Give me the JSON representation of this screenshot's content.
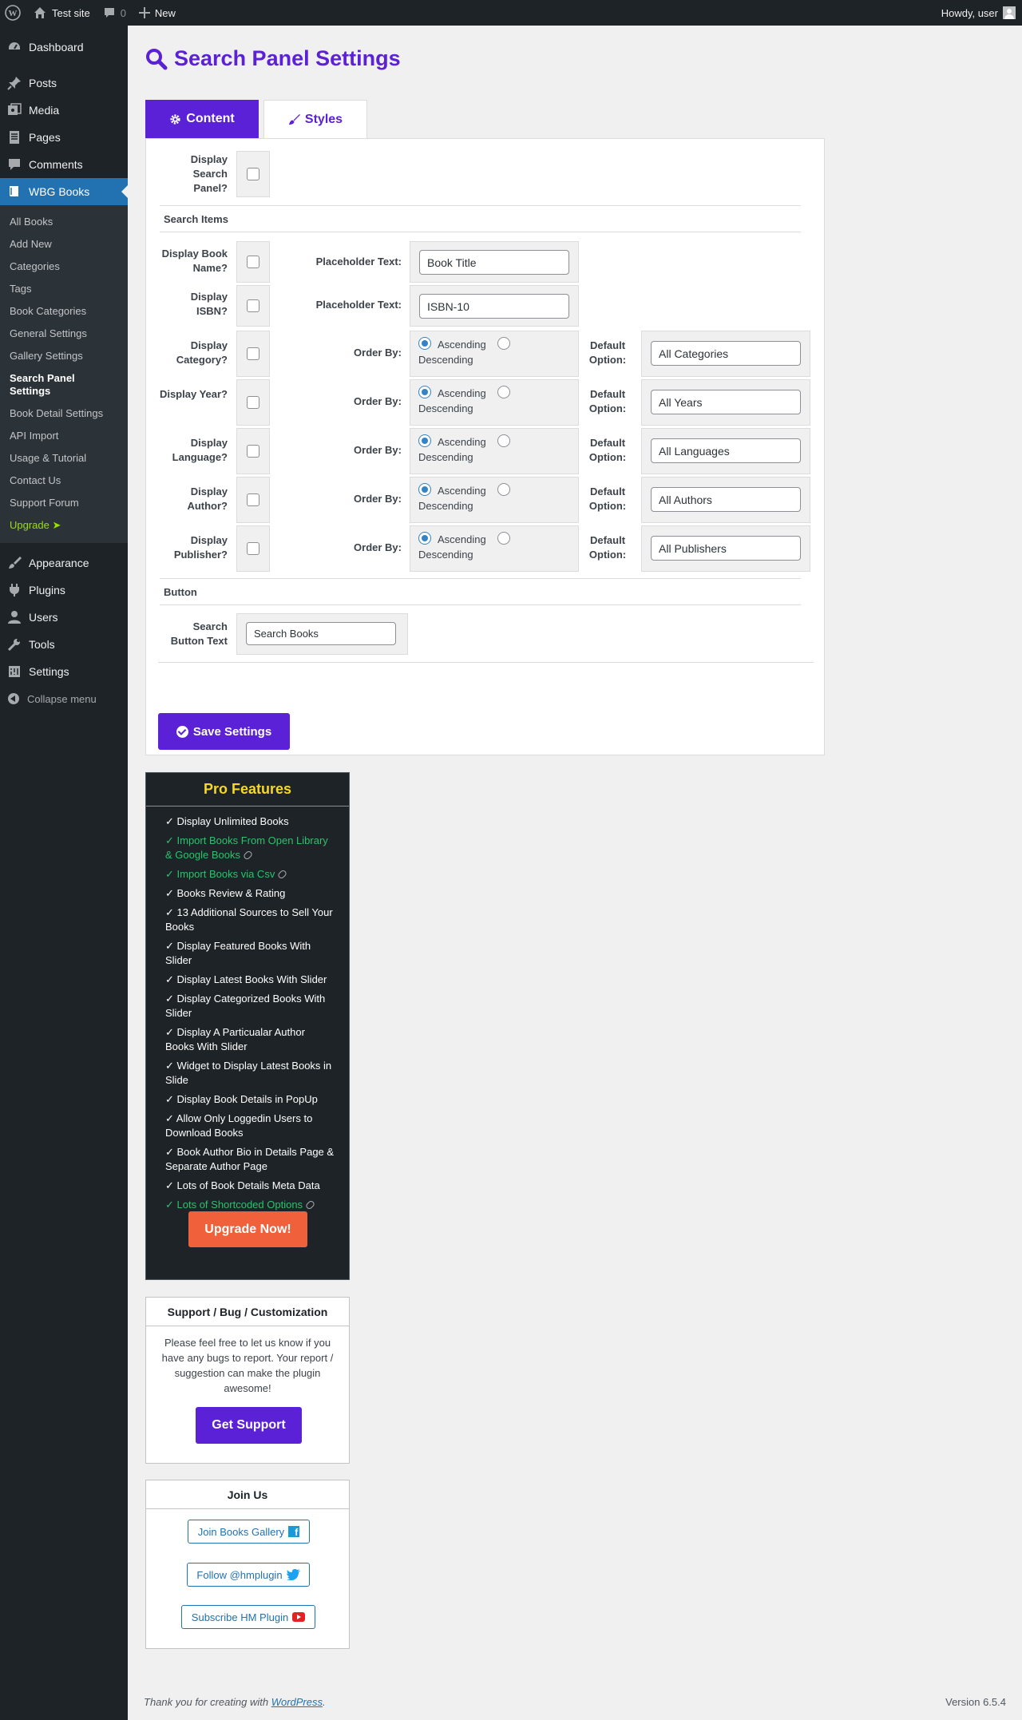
{
  "adminbar": {
    "site_name": "Test site",
    "comments_count": "0",
    "new_label": "New",
    "howdy": "Howdy, user"
  },
  "sidebar": {
    "top_items": [
      {
        "label": "Dashboard",
        "icon": "dashboard-icon"
      },
      {
        "label": "Posts",
        "icon": "pin-icon"
      },
      {
        "label": "Media",
        "icon": "media-icon"
      },
      {
        "label": "Pages",
        "icon": "pages-icon"
      },
      {
        "label": "Comments",
        "icon": "comment-icon"
      },
      {
        "label": "WBG Books",
        "icon": "book-icon"
      }
    ],
    "submenu": [
      "All Books",
      "Add New",
      "Categories",
      "Tags",
      "Book Categories",
      "General Settings",
      "Gallery Settings",
      "Search Panel Settings",
      "Book Detail Settings",
      "API Import",
      "Usage & Tutorial",
      "Contact Us",
      "Support Forum",
      "Upgrade ➤"
    ],
    "bottom_items": [
      {
        "label": "Appearance",
        "icon": "brush-icon"
      },
      {
        "label": "Plugins",
        "icon": "plugin-icon"
      },
      {
        "label": "Users",
        "icon": "user-icon"
      },
      {
        "label": "Tools",
        "icon": "wrench-icon"
      },
      {
        "label": "Settings",
        "icon": "settings-icon"
      }
    ],
    "collapse": "Collapse menu"
  },
  "page": {
    "title": "Search Panel Settings",
    "tabs": {
      "content": "Content",
      "styles": "Styles"
    }
  },
  "form": {
    "display_search_panel": "Display Search Panel?",
    "section_search_items": "Search Items",
    "book_name": {
      "label": "Display Book Name?",
      "ph_label": "Placeholder Text:",
      "value": "Book Title"
    },
    "isbn": {
      "label": "Display ISBN?",
      "ph_label": "Placeholder Text:",
      "value": "ISBN-10"
    },
    "order_by_label": "Order By:",
    "ascending": "Ascending",
    "descending": "Descending",
    "default_option_label": "Default Option:",
    "rows": [
      {
        "label": "Display Category?",
        "default": "All Categories"
      },
      {
        "label": "Display Year?",
        "default": "All Years"
      },
      {
        "label": "Display Language?",
        "default": "All Languages"
      },
      {
        "label": "Display Author?",
        "default": "All Authors"
      },
      {
        "label": "Display Publisher?",
        "default": "All Publishers"
      }
    ],
    "section_button": "Button",
    "search_button_label": "Search Button Text",
    "search_button_value": "Search Books",
    "save": "Save Settings"
  },
  "pro": {
    "title": "Pro Features",
    "items": [
      {
        "text": "✓ Display Unlimited Books",
        "link": false
      },
      {
        "text": "✓ Import Books From Open Library & Google Books",
        "link": true
      },
      {
        "text": "✓ Import Books via Csv",
        "link": true
      },
      {
        "text": "✓ Books Review & Rating",
        "link": false
      },
      {
        "text": "✓ 13 Additional Sources to Sell Your Books",
        "link": false
      },
      {
        "text": "✓ Display Featured Books With Slider",
        "link": false
      },
      {
        "text": "✓ Display Latest Books With Slider",
        "link": false
      },
      {
        "text": "✓ Display Categorized Books With Slider",
        "link": false
      },
      {
        "text": "✓ Display A Particualar Author Books With Slider",
        "link": false
      },
      {
        "text": "✓ Widget to Display Latest Books in Slide",
        "link": false
      },
      {
        "text": "✓ Display Book Details in PopUp",
        "link": false
      },
      {
        "text": "✓ Allow Only Loggedin Users to Download Books",
        "link": false
      },
      {
        "text": "✓ Book Author Bio in Details Page & Separate Author Page",
        "link": false
      },
      {
        "text": "✓ Lots of Book Details Meta Data",
        "link": false
      },
      {
        "text": "✓ Lots of Shortcoded Options",
        "link": true
      }
    ],
    "upgrade": "Upgrade Now!"
  },
  "support": {
    "title": "Support / Bug / Customization",
    "text": "Please feel free to let us know if you have any bugs to report. Your report / suggestion can make the plugin awesome!",
    "button": "Get Support"
  },
  "join": {
    "title": "Join Us",
    "facebook": "Join Books Gallery",
    "twitter": "Follow @hmplugin",
    "youtube": "Subscribe HM Plugin"
  },
  "footer": {
    "thanks_prefix": "Thank you for creating with ",
    "wordpress": "WordPress",
    "thanks_suffix": ".",
    "version": "Version 6.5.4"
  },
  "colors": {
    "accent": "#5b21d6",
    "admin_dark": "#1d2327",
    "wp_blue": "#2271b1",
    "upgrade_orange": "#f0603a"
  }
}
